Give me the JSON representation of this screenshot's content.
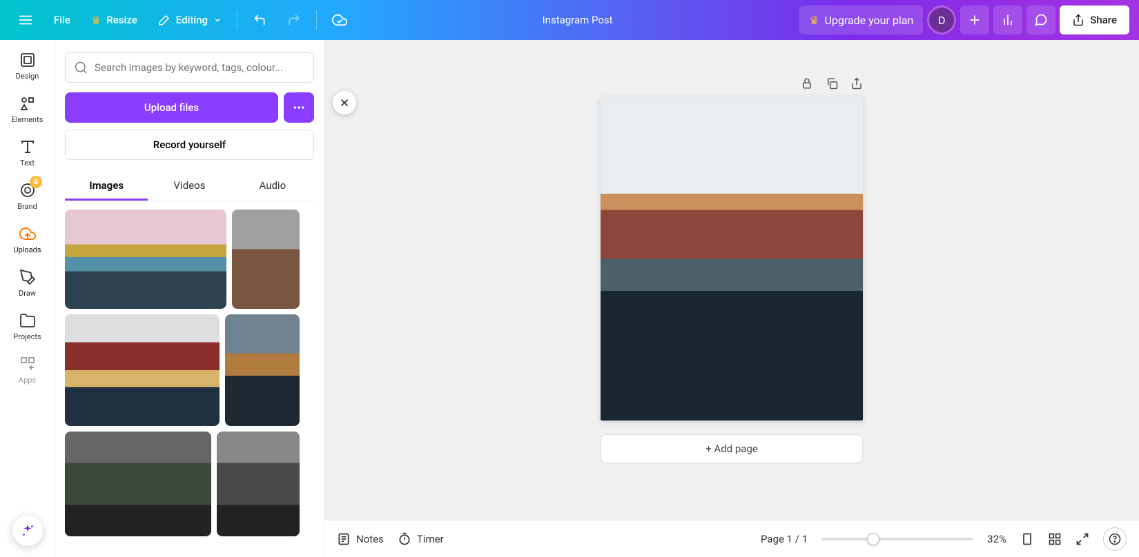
{
  "header": {
    "file_label": "File",
    "resize_label": "Resize",
    "editing_label": "Editing",
    "doc_title": "Instagram Post",
    "upgrade_label": "Upgrade your plan",
    "share_label": "Share",
    "avatar_initial": "D"
  },
  "rail": {
    "items": [
      {
        "label": "Design"
      },
      {
        "label": "Elements"
      },
      {
        "label": "Text"
      },
      {
        "label": "Brand"
      },
      {
        "label": "Uploads"
      },
      {
        "label": "Draw"
      },
      {
        "label": "Projects"
      },
      {
        "label": "Apps"
      }
    ]
  },
  "panel": {
    "search_placeholder": "Search images by keyword, tags, colour...",
    "upload_label": "Upload files",
    "record_label": "Record yourself",
    "tabs": [
      {
        "label": "Images",
        "active": true
      },
      {
        "label": "Videos",
        "active": false
      },
      {
        "label": "Audio",
        "active": false
      }
    ]
  },
  "canvas": {
    "add_page_label": "+ Add page"
  },
  "bottombar": {
    "notes_label": "Notes",
    "timer_label": "Timer",
    "page_indicator": "Page 1 / 1",
    "zoom_label": "32%"
  }
}
